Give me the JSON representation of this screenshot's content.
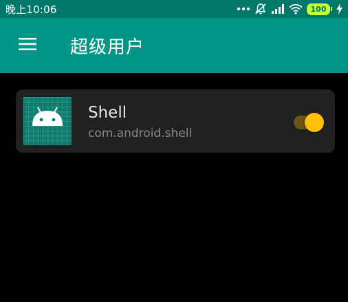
{
  "status_bar": {
    "time": "晚上10:06",
    "battery_level": "100",
    "icons": [
      "more-dots-icon",
      "silent-mode-icon",
      "cell-signal-icon",
      "wifi-icon",
      "battery-icon",
      "charging-bolt-icon"
    ],
    "background_color": "#00796b"
  },
  "app_bar": {
    "title": "超级用户",
    "menu_icon": "hamburger-menu-icon",
    "background_color": "#009688"
  },
  "app_list": [
    {
      "name": "Shell",
      "package": "com.android.shell",
      "icon": "android-robot-icon",
      "enabled": true
    }
  ],
  "colors": {
    "card_background": "#212121",
    "toggle_thumb": "#ffc107",
    "toggle_track": "#6a5514"
  }
}
